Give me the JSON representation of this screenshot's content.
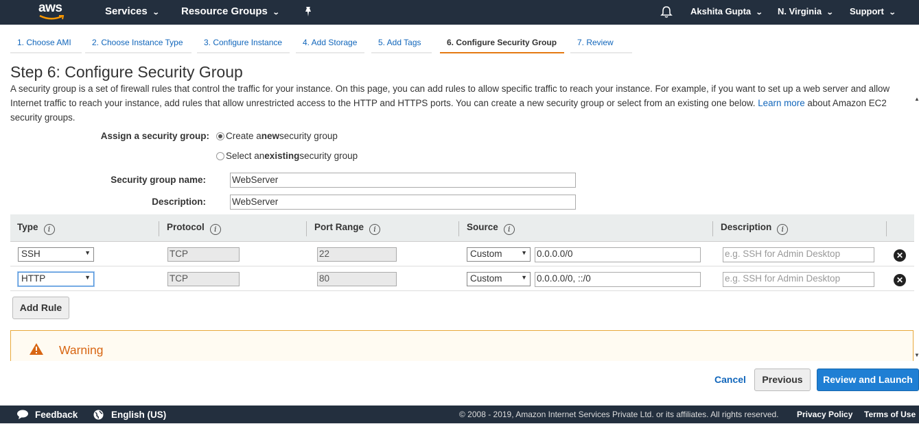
{
  "nav": {
    "logo_text": "aws",
    "services": "Services",
    "resource_groups": "Resource Groups",
    "user": "Akshita Gupta",
    "region": "N. Virginia",
    "support": "Support"
  },
  "steps": [
    {
      "label": "1. Choose AMI"
    },
    {
      "label": "2. Choose Instance Type"
    },
    {
      "label": "3. Configure Instance"
    },
    {
      "label": "4. Add Storage"
    },
    {
      "label": "5. Add Tags"
    },
    {
      "label": "6. Configure Security Group",
      "active": true
    },
    {
      "label": "7. Review"
    }
  ],
  "page": {
    "title": "Step 6: Configure Security Group",
    "intro_1": "A security group is a set of firewall rules that control the traffic for your instance. On this page, you can add rules to allow specific traffic to reach your instance. For example, if you want to set up a web server and allow Internet traffic to reach your instance, add rules that allow unrestricted access to the HTTP and HTTPS ports. You can create a new security group or select from an existing one below.",
    "learn_more": "Learn more",
    "intro_2": "about Amazon EC2 security groups."
  },
  "assign": {
    "label": "Assign a security group:",
    "option_new_pre": "Create a ",
    "option_new_bold": "new",
    "option_new_post": " security group",
    "option_existing_pre": "Select an ",
    "option_existing_bold": "existing",
    "option_existing_post": " security group",
    "selected": "new"
  },
  "form": {
    "name_label": "Security group name:",
    "name_value": "WebServer",
    "desc_label": "Description:",
    "desc_value": "WebServer"
  },
  "table": {
    "headers": {
      "type": "Type",
      "protocol": "Protocol",
      "port_range": "Port Range",
      "source": "Source",
      "description": "Description"
    },
    "info_glyph": "i",
    "rows": [
      {
        "type": "SSH",
        "protocol": "TCP",
        "port": "22",
        "source_mode": "Custom",
        "source": "0.0.0.0/0",
        "description_placeholder": "e.g. SSH for Admin Desktop"
      },
      {
        "type": "HTTP",
        "protocol": "TCP",
        "port": "80",
        "source_mode": "Custom",
        "source": "0.0.0.0/0, ::/0",
        "description_placeholder": "e.g. SSH for Admin Desktop"
      }
    ]
  },
  "add_rule": "Add Rule",
  "warning": {
    "title": "Warning"
  },
  "actions": {
    "cancel": "Cancel",
    "previous": "Previous",
    "review_launch": "Review and Launch"
  },
  "footer": {
    "feedback": "Feedback",
    "language": "English (US)",
    "copyright": "© 2008 - 2019, Amazon Internet Services Private Ltd. or its affiliates. All rights reserved.",
    "privacy": "Privacy Policy",
    "terms": "Terms of Use"
  },
  "colors": {
    "nav_bg": "#232f3e",
    "link": "#1166bb",
    "tab_active": "#e47911",
    "primary": "#1f7fd4",
    "warning_text": "#d86613"
  }
}
